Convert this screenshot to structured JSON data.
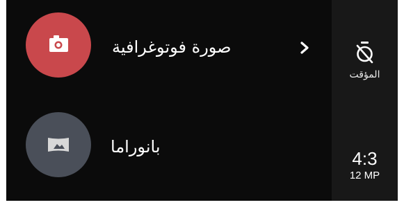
{
  "modes": [
    {
      "label": "صورة فوتوغرافية",
      "icon": "camera-icon",
      "color": "#c9484c",
      "has_submenu": true
    },
    {
      "label": "بانوراما",
      "icon": "panorama-icon",
      "color": "#4a4f59",
      "has_submenu": false
    }
  ],
  "sidebar": {
    "timer": {
      "label": "المؤقت",
      "icon": "timer-off-icon"
    },
    "aspect": {
      "ratio": "4:3",
      "resolution": "12 MP"
    }
  },
  "colors": {
    "background": "#0b0b0b",
    "sidebar_background": "#181818",
    "text": "#ffffff"
  }
}
